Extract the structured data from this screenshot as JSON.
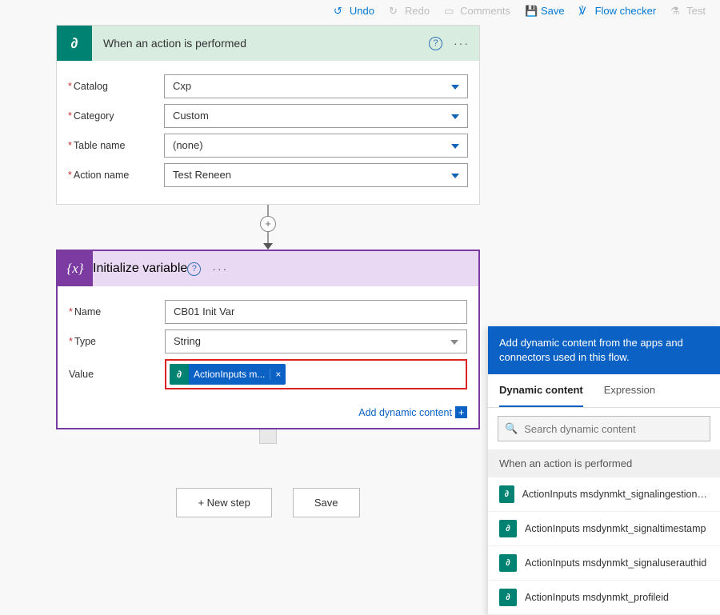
{
  "toolbar": {
    "undo": "Undo",
    "redo": "Redo",
    "comments": "Comments",
    "save": "Save",
    "flow_checker": "Flow checker",
    "test": "Test"
  },
  "trigger": {
    "title": "When an action is performed",
    "fields": {
      "catalog": {
        "label": "Catalog",
        "value": "Cxp"
      },
      "category": {
        "label": "Category",
        "value": "Custom"
      },
      "table": {
        "label": "Table name",
        "value": "(none)"
      },
      "action": {
        "label": "Action name",
        "value": "Test Reneen"
      }
    }
  },
  "init_var": {
    "title": "Initialize variable",
    "fields": {
      "name": {
        "label": "Name",
        "value": "CB01 Init Var"
      },
      "type": {
        "label": "Type",
        "value": "String"
      },
      "value_label": "Value"
    },
    "token": "ActionInputs m...",
    "dyn_link": "Add dynamic content"
  },
  "buttons": {
    "new_step": "+ New step",
    "save": "Save"
  },
  "panel": {
    "banner": "Add dynamic content from the apps and connectors used in this flow.",
    "tabs": {
      "dynamic": "Dynamic content",
      "expression": "Expression"
    },
    "search_ph": "Search dynamic content",
    "group": "When an action is performed",
    "options": [
      "ActionInputs msdynmkt_signalingestiontimestamp",
      "ActionInputs msdynmkt_signaltimestamp",
      "ActionInputs msdynmkt_signaluserauthid",
      "ActionInputs msdynmkt_profileid"
    ]
  }
}
